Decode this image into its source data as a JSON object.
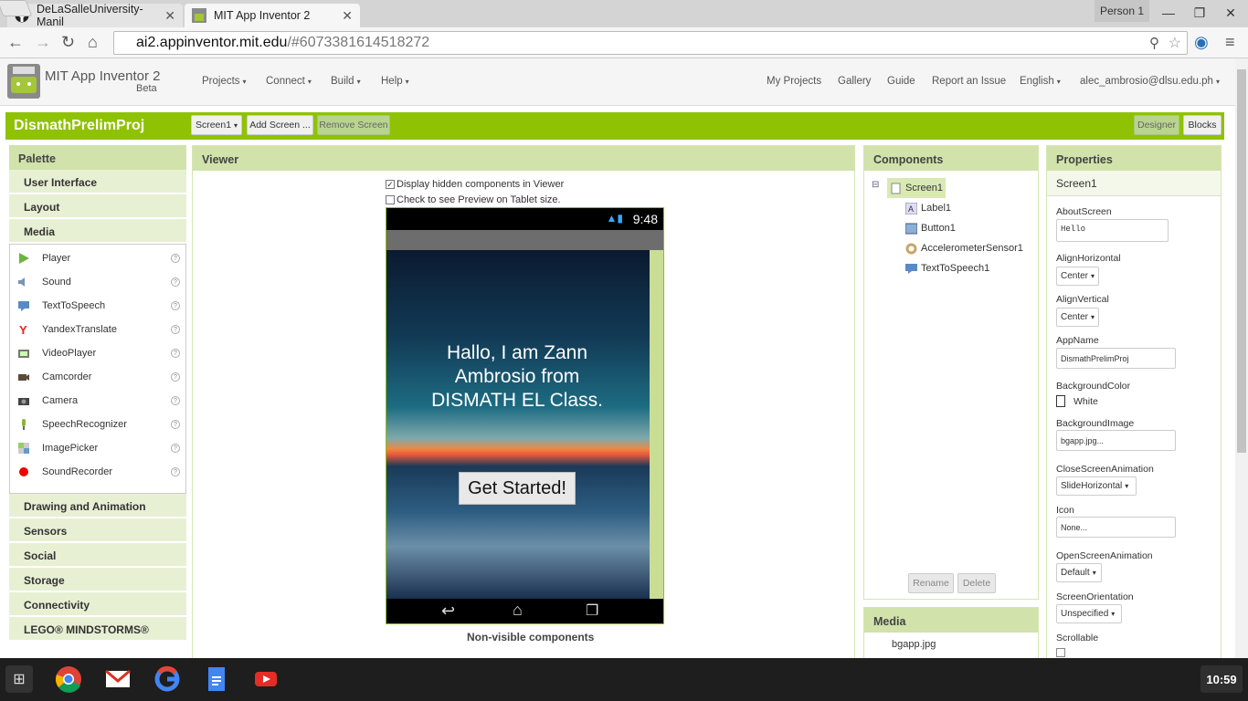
{
  "browser": {
    "tabs": [
      {
        "title": "DeLaSalleUniversity-Manil"
      },
      {
        "title": "MIT App Inventor 2"
      }
    ],
    "profile": "Person 1",
    "url_domain": "ai2.appinventor.mit.edu",
    "url_path": "/#6073381614518272"
  },
  "header": {
    "brand": "MIT App Inventor 2",
    "beta": "Beta",
    "menus": [
      "Projects",
      "Connect",
      "Build",
      "Help"
    ],
    "right_links": [
      "My Projects",
      "Gallery",
      "Guide",
      "Report an Issue",
      "English",
      "alec_ambrosio@dlsu.edu.ph"
    ]
  },
  "project": {
    "name": "DismathPrelimProj",
    "screen_select": "Screen1",
    "add_screen": "Add Screen ...",
    "remove_screen": "Remove Screen",
    "designer": "Designer",
    "blocks": "Blocks"
  },
  "palette": {
    "title": "Palette",
    "categories_top": [
      "User Interface",
      "Layout",
      "Media"
    ],
    "media_items": [
      "Player",
      "Sound",
      "TextToSpeech",
      "YandexTranslate",
      "VideoPlayer",
      "Camcorder",
      "Camera",
      "SpeechRecognizer",
      "ImagePicker",
      "SoundRecorder"
    ],
    "categories_bottom": [
      "Drawing and Animation",
      "Sensors",
      "Social",
      "Storage",
      "Connectivity",
      "LEGO® MINDSTORMS®"
    ]
  },
  "viewer": {
    "title": "Viewer",
    "display_hidden": "Display hidden components in Viewer",
    "display_hidden_checked": true,
    "tablet_preview": "Check to see Preview on Tablet size.",
    "tablet_preview_checked": false,
    "phone_time": "9:48",
    "label_text": "Hallo, I am Zann Ambrosio from DISMATH EL Class.",
    "button_text": "Get Started!",
    "nonvisible": "Non-visible components"
  },
  "components": {
    "title": "Components",
    "root": "Screen1",
    "children": [
      "Label1",
      "Button1",
      "AccelerometerSensor1",
      "TextToSpeech1"
    ],
    "rename": "Rename",
    "delete": "Delete"
  },
  "media": {
    "title": "Media",
    "files": [
      "bgapp.jpg"
    ]
  },
  "properties": {
    "title": "Properties",
    "screen": "Screen1",
    "about_label": "AboutScreen",
    "about_value": "Hello",
    "alignh_label": "AlignHorizontal",
    "alignh_value": "Center",
    "alignv_label": "AlignVertical",
    "alignv_value": "Center",
    "appname_label": "AppName",
    "appname_value": "DismathPrelimProj",
    "bgcolor_label": "BackgroundColor",
    "bgcolor_value": "White",
    "bgimage_label": "BackgroundImage",
    "bgimage_value": "bgapp.jpg...",
    "closeanim_label": "CloseScreenAnimation",
    "closeanim_value": "SlideHorizontal",
    "icon_label": "Icon",
    "icon_value": "None...",
    "openanim_label": "OpenScreenAnimation",
    "openanim_value": "Default",
    "orient_label": "ScreenOrientation",
    "orient_value": "Unspecified",
    "scroll_label": "Scrollable"
  },
  "taskbar": {
    "apps": [
      "apps-launcher-icon",
      "chrome-icon",
      "gmail-icon",
      "google-icon",
      "docs-icon",
      "youtube-icon"
    ],
    "clock": "10:59"
  },
  "colors": {
    "accent_green": "#8fc202",
    "panel_header": "#d1e2ab"
  }
}
